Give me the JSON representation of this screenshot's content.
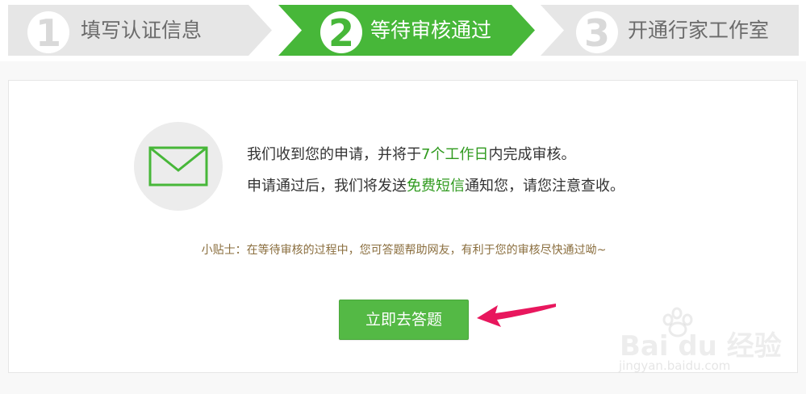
{
  "steps": [
    {
      "number": "1",
      "label": "填写认证信息",
      "state": "done"
    },
    {
      "number": "2",
      "label": "等待审核通过",
      "state": "active"
    },
    {
      "number": "3",
      "label": "开通行家工作室",
      "state": "pending"
    }
  ],
  "colors": {
    "accent": "#47b739",
    "inactive_step": "#e6e6e6",
    "highlight_text": "#2f9a1e",
    "tip_text": "#8a6e3e",
    "arrow": "#e8175d"
  },
  "message": {
    "icon": "envelope-icon",
    "line1_prefix": "我们收到您的申请，并将于",
    "line1_highlight": "7个工作日",
    "line1_suffix": "内完成审核。",
    "line2_prefix": "申请通过后，我们将发送",
    "line2_highlight": "免费短信",
    "line2_suffix": "通知您，请您注意查收。"
  },
  "tip": "小贴士：在等待审核的过程中，您可答题帮助网友，有利于您的审核尽快通过呦~",
  "answer_button": {
    "label": "立即去答题"
  },
  "watermark": {
    "brand": "Bai du 经验",
    "url": "jingyan.baidu.com"
  }
}
